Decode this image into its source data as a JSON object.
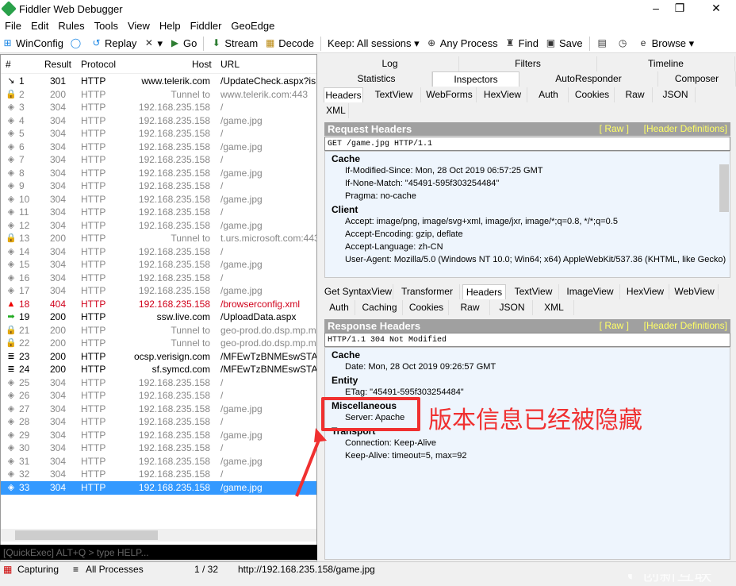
{
  "window": {
    "title": "Fiddler Web Debugger",
    "minimize": "–",
    "maximize": "❐",
    "close": "✕"
  },
  "menu": [
    "File",
    "Edit",
    "Rules",
    "Tools",
    "View",
    "Help",
    "Fiddler",
    "GeoEdge"
  ],
  "toolbar": [
    {
      "icon": "windows-icon",
      "glyph": "⊞",
      "label": "WinConfig"
    },
    {
      "icon": "comment-icon",
      "glyph": "◯",
      "label": ""
    },
    {
      "icon": "replay-icon",
      "glyph": "↺",
      "label": "Replay"
    },
    {
      "icon": "remove-icon",
      "glyph": "✕",
      "label": "▾"
    },
    {
      "icon": "go-icon",
      "glyph": "▶",
      "label": "Go"
    },
    {
      "icon": "stream-icon",
      "glyph": "⬇",
      "label": "Stream"
    },
    {
      "icon": "decode-icon",
      "glyph": "▦",
      "label": "Decode"
    },
    {
      "icon": "",
      "glyph": "",
      "label": "Keep: All sessions ▾"
    },
    {
      "icon": "crosshair-icon",
      "glyph": "⊕",
      "label": "Any Process"
    },
    {
      "icon": "binoculars-icon",
      "glyph": "♜",
      "label": "Find"
    },
    {
      "icon": "save-icon",
      "glyph": "▣",
      "label": "Save"
    },
    {
      "icon": "screenshot-icon",
      "glyph": "▤",
      "label": ""
    },
    {
      "icon": "timer-icon",
      "glyph": "◷",
      "label": ""
    },
    {
      "icon": "browser-icon",
      "glyph": "e",
      "label": "Browse ▾"
    }
  ],
  "sessions": {
    "columns": [
      "#",
      "Result",
      "Protocol",
      "Host",
      "URL"
    ],
    "rows": [
      {
        "icon": "redirect",
        "id": "1",
        "result": "301",
        "protocol": "HTTP",
        "host": "www.telerik.com",
        "url": "/UpdateCheck.aspx?isBet",
        "style": "normal"
      },
      {
        "icon": "lock",
        "id": "2",
        "result": "200",
        "protocol": "HTTP",
        "host": "Tunnel to",
        "url": "www.telerik.com:443",
        "style": "gray"
      },
      {
        "icon": "diamond",
        "id": "3",
        "result": "304",
        "protocol": "HTTP",
        "host": "192.168.235.158",
        "url": "/",
        "style": "gray"
      },
      {
        "icon": "diamond",
        "id": "4",
        "result": "304",
        "protocol": "HTTP",
        "host": "192.168.235.158",
        "url": "/game.jpg",
        "style": "gray"
      },
      {
        "icon": "diamond",
        "id": "5",
        "result": "304",
        "protocol": "HTTP",
        "host": "192.168.235.158",
        "url": "/",
        "style": "gray"
      },
      {
        "icon": "diamond",
        "id": "6",
        "result": "304",
        "protocol": "HTTP",
        "host": "192.168.235.158",
        "url": "/game.jpg",
        "style": "gray"
      },
      {
        "icon": "diamond",
        "id": "7",
        "result": "304",
        "protocol": "HTTP",
        "host": "192.168.235.158",
        "url": "/",
        "style": "gray"
      },
      {
        "icon": "diamond",
        "id": "8",
        "result": "304",
        "protocol": "HTTP",
        "host": "192.168.235.158",
        "url": "/game.jpg",
        "style": "gray"
      },
      {
        "icon": "diamond",
        "id": "9",
        "result": "304",
        "protocol": "HTTP",
        "host": "192.168.235.158",
        "url": "/",
        "style": "gray"
      },
      {
        "icon": "diamond",
        "id": "10",
        "result": "304",
        "protocol": "HTTP",
        "host": "192.168.235.158",
        "url": "/game.jpg",
        "style": "gray"
      },
      {
        "icon": "diamond",
        "id": "11",
        "result": "304",
        "protocol": "HTTP",
        "host": "192.168.235.158",
        "url": "/",
        "style": "gray"
      },
      {
        "icon": "diamond",
        "id": "12",
        "result": "304",
        "protocol": "HTTP",
        "host": "192.168.235.158",
        "url": "/game.jpg",
        "style": "gray"
      },
      {
        "icon": "lock",
        "id": "13",
        "result": "200",
        "protocol": "HTTP",
        "host": "Tunnel to",
        "url": "t.urs.microsoft.com:443",
        "style": "gray"
      },
      {
        "icon": "diamond",
        "id": "14",
        "result": "304",
        "protocol": "HTTP",
        "host": "192.168.235.158",
        "url": "/",
        "style": "gray"
      },
      {
        "icon": "diamond",
        "id": "15",
        "result": "304",
        "protocol": "HTTP",
        "host": "192.168.235.158",
        "url": "/game.jpg",
        "style": "gray"
      },
      {
        "icon": "diamond",
        "id": "16",
        "result": "304",
        "protocol": "HTTP",
        "host": "192.168.235.158",
        "url": "/",
        "style": "gray"
      },
      {
        "icon": "diamond",
        "id": "17",
        "result": "304",
        "protocol": "HTTP",
        "host": "192.168.235.158",
        "url": "/game.jpg",
        "style": "gray"
      },
      {
        "icon": "warning",
        "id": "18",
        "result": "404",
        "protocol": "HTTP",
        "host": "192.168.235.158",
        "url": "/browserconfig.xml",
        "style": "red"
      },
      {
        "icon": "upload",
        "id": "19",
        "result": "200",
        "protocol": "HTTP",
        "host": "ssw.live.com",
        "url": "/UploadData.aspx",
        "style": "normal"
      },
      {
        "icon": "lock",
        "id": "21",
        "result": "200",
        "protocol": "HTTP",
        "host": "Tunnel to",
        "url": "geo-prod.do.dsp.mp.micr",
        "style": "gray"
      },
      {
        "icon": "lock",
        "id": "22",
        "result": "200",
        "protocol": "HTTP",
        "host": "Tunnel to",
        "url": "geo-prod.do.dsp.mp.micr",
        "style": "gray"
      },
      {
        "icon": "document",
        "id": "23",
        "result": "200",
        "protocol": "HTTP",
        "host": "ocsp.verisign.com",
        "url": "/MFEwTzBNMEswSTAJBgU",
        "style": "normal"
      },
      {
        "icon": "document",
        "id": "24",
        "result": "200",
        "protocol": "HTTP",
        "host": "sf.symcd.com",
        "url": "/MFEwTzBNMEswSTAJBgU",
        "style": "normal"
      },
      {
        "icon": "diamond",
        "id": "25",
        "result": "304",
        "protocol": "HTTP",
        "host": "192.168.235.158",
        "url": "/",
        "style": "gray"
      },
      {
        "icon": "diamond",
        "id": "26",
        "result": "304",
        "protocol": "HTTP",
        "host": "192.168.235.158",
        "url": "/",
        "style": "gray"
      },
      {
        "icon": "diamond",
        "id": "27",
        "result": "304",
        "protocol": "HTTP",
        "host": "192.168.235.158",
        "url": "/game.jpg",
        "style": "gray"
      },
      {
        "icon": "diamond",
        "id": "28",
        "result": "304",
        "protocol": "HTTP",
        "host": "192.168.235.158",
        "url": "/",
        "style": "gray"
      },
      {
        "icon": "diamond",
        "id": "29",
        "result": "304",
        "protocol": "HTTP",
        "host": "192.168.235.158",
        "url": "/game.jpg",
        "style": "gray"
      },
      {
        "icon": "diamond",
        "id": "30",
        "result": "304",
        "protocol": "HTTP",
        "host": "192.168.235.158",
        "url": "/",
        "style": "gray"
      },
      {
        "icon": "diamond",
        "id": "31",
        "result": "304",
        "protocol": "HTTP",
        "host": "192.168.235.158",
        "url": "/game.jpg",
        "style": "gray"
      },
      {
        "icon": "diamond",
        "id": "32",
        "result": "304",
        "protocol": "HTTP",
        "host": "192.168.235.158",
        "url": "/",
        "style": "gray"
      },
      {
        "icon": "diamond",
        "id": "33",
        "result": "304",
        "protocol": "HTTP",
        "host": "192.168.235.158",
        "url": "/game.jpg",
        "style": "sel"
      }
    ]
  },
  "quickexec": {
    "placeholder": "[QuickExec] ALT+Q > type HELP..."
  },
  "status": {
    "capturing": "Capturing",
    "processes": "All Processes",
    "count": "1 / 32",
    "url": "http://192.168.235.158/game.jpg"
  },
  "topTabs": {
    "row1": [
      "Log",
      "Filters",
      "Timeline"
    ],
    "row2": [
      "Statistics",
      "Inspectors",
      "AutoResponder",
      "Composer"
    ],
    "active": "Inspectors"
  },
  "request": {
    "tabs": [
      "Headers",
      "TextView",
      "WebForms",
      "HexView",
      "Auth",
      "Cookies",
      "Raw",
      "JSON",
      "XML"
    ],
    "active": "Headers",
    "title": "Request Headers",
    "raw": "[ Raw ]",
    "defs": "[Header Definitions]",
    "firstLine": "GET /game.jpg HTTP/1.1",
    "groups": [
      {
        "name": "Cache",
        "items": [
          "If-Modified-Since: Mon, 28 Oct 2019 06:57:25 GMT",
          "If-None-Match: \"45491-595f303254484\"",
          "Pragma: no-cache"
        ]
      },
      {
        "name": "Client",
        "items": [
          "Accept: image/png, image/svg+xml, image/jxr, image/*;q=0.8, */*;q=0.5",
          "Accept-Encoding: gzip, deflate",
          "Accept-Language: zh-CN",
          "User-Agent: Mozilla/5.0 (Windows NT 10.0; Win64; x64) AppleWebKit/537.36 (KHTML, like Gecko)"
        ]
      }
    ]
  },
  "response": {
    "tabs1": [
      "Get SyntaxView",
      "Transformer",
      "Headers",
      "TextView",
      "ImageView",
      "HexView",
      "WebView"
    ],
    "tabs2": [
      "Auth",
      "Caching",
      "Cookies",
      "Raw",
      "JSON",
      "XML"
    ],
    "active": "Headers",
    "title": "Response Headers",
    "raw": "[ Raw ]",
    "defs": "[Header Definitions]",
    "firstLine": "HTTP/1.1 304 Not Modified",
    "groups": [
      {
        "name": "Cache",
        "items": [
          "Date: Mon, 28 Oct 2019 09:26:57 GMT"
        ]
      },
      {
        "name": "Entity",
        "items": [
          "ETag: \"45491-595f303254484\""
        ]
      },
      {
        "name": "Miscellaneous",
        "items": [
          "Server: Apache"
        ]
      },
      {
        "name": "Transport",
        "items": [
          "Connection: Keep-Alive",
          "Keep-Alive: timeout=5, max=92"
        ]
      }
    ]
  },
  "annotation": {
    "text": "版本信息已经被隐藏",
    "color": "#f03030"
  },
  "watermark": "创新互联"
}
